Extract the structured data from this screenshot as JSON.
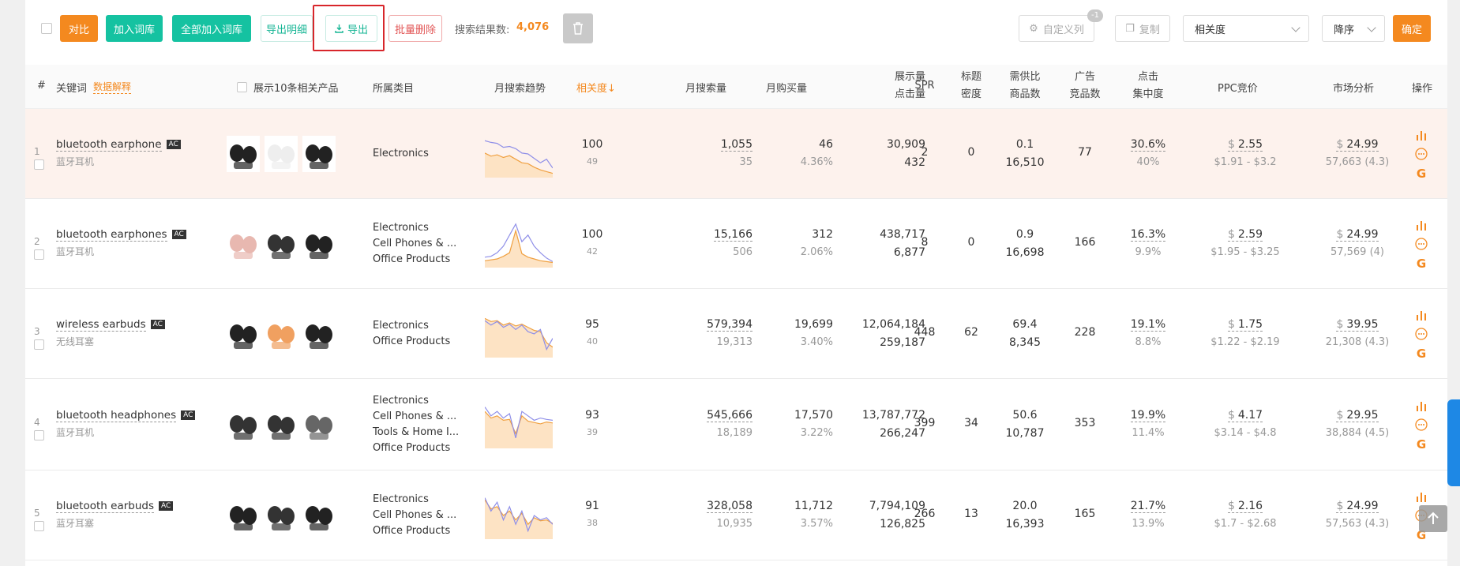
{
  "toolbar": {
    "compare": "对比",
    "add_to_library": "加入词库",
    "add_all_to_library": "全部加入词库",
    "export_detail": "导出明细",
    "export": "导出",
    "batch_delete": "批量删除",
    "result_label": "搜索结果数:",
    "result_count": "4,076",
    "custom_columns": "自定义列",
    "custom_columns_badge": "-1",
    "copy": "复制",
    "sort_field": "相关度",
    "sort_order": "降序",
    "confirm": "确定"
  },
  "headers": {
    "index": "#",
    "keyword": "关键词",
    "data_explain": "数据解释",
    "show_products": "展示10条相关产品",
    "category": "所属类目",
    "trend": "月搜索趋势",
    "relevance": "相关度↓",
    "monthly_search": "月搜索量",
    "monthly_purchase": "月购买量",
    "impressions": "展示量",
    "clicks": "点击量",
    "spr": "SPR",
    "title_density_1": "标题",
    "title_density_2": "密度",
    "supply_demand_1": "需供比",
    "supply_demand_2": "商品数",
    "ads_1": "广告",
    "ads_2": "竞品数",
    "click_conc_1": "点击",
    "click_conc_2": "集中度",
    "ppc": "PPC竞价",
    "market": "市场分析",
    "ops": "操作"
  },
  "rows": [
    {
      "index": "1",
      "keyword": "bluetooth earphone",
      "ac": "AC",
      "translation": "蓝牙耳机",
      "categories": [
        "Electronics"
      ],
      "relevance": "100",
      "relevance_sub": "49",
      "search": "1,055",
      "search_sub": "35",
      "purchase": "46",
      "purchase_sub": "4.36%",
      "impressions": "30,909",
      "clicks": "432",
      "spr": "2",
      "density": "0",
      "ratio": "0.1",
      "products": "16,510",
      "ads": "77",
      "conc": "30.6%",
      "conc_sub": "40%",
      "ppc_symbol": "$",
      "ppc": "2.55",
      "ppc_range": "$1.91 - $3.2",
      "price_symbol": "$",
      "price": "24.99",
      "price_sub": "57,663 (4.3)",
      "trend_blue": [
        0.2,
        0.24,
        0.26,
        0.35,
        0.33,
        0.38,
        0.48,
        0.5,
        0.6,
        0.7,
        0.62,
        0.82
      ],
      "trend_orange": [
        0.48,
        0.55,
        0.52,
        0.58,
        0.54,
        0.62,
        0.7,
        0.72,
        0.8,
        0.86,
        0.9,
        0.94
      ]
    },
    {
      "index": "2",
      "keyword": "bluetooth earphones",
      "ac": "AC",
      "translation": "蓝牙耳机",
      "categories": [
        "Electronics",
        "Cell Phones & ...",
        "Office Products"
      ],
      "relevance": "100",
      "relevance_sub": "42",
      "search": "15,166",
      "search_sub": "506",
      "purchase": "312",
      "purchase_sub": "2.06%",
      "impressions": "438,717",
      "clicks": "6,877",
      "spr": "8",
      "density": "0",
      "ratio": "0.9",
      "products": "16,698",
      "ads": "166",
      "conc": "16.3%",
      "conc_sub": "9.9%",
      "ppc_symbol": "$",
      "ppc": "2.59",
      "ppc_range": "$1.95 - $3.25",
      "price_symbol": "$",
      "price": "24.99",
      "price_sub": "57,569 (4)",
      "trend_blue": [
        0.8,
        0.78,
        0.7,
        0.55,
        0.3,
        0.05,
        0.45,
        0.3,
        0.55,
        0.7,
        0.82,
        0.9
      ],
      "trend_orange": [
        0.88,
        0.86,
        0.84,
        0.78,
        0.7,
        0.2,
        0.72,
        0.8,
        0.84,
        0.88,
        0.9,
        0.92
      ]
    },
    {
      "index": "3",
      "keyword": "wireless earbuds",
      "ac": "AC",
      "translation": "无线耳塞",
      "categories": [
        "Electronics",
        "Office Products"
      ],
      "relevance": "95",
      "relevance_sub": "40",
      "search": "579,394",
      "search_sub": "19,313",
      "purchase": "19,699",
      "purchase_sub": "3.40%",
      "impressions": "12,064,184",
      "clicks": "259,187",
      "spr": "448",
      "density": "62",
      "ratio": "69.4",
      "products": "8,345",
      "ads": "228",
      "conc": "19.1%",
      "conc_sub": "8.8%",
      "ppc_symbol": "$",
      "ppc": "1.75",
      "ppc_range": "$1.22 - $2.19",
      "price_symbol": "$",
      "price": "39.95",
      "price_sub": "21,308 (4.3)",
      "trend_blue": [
        0.2,
        0.3,
        0.22,
        0.35,
        0.28,
        0.4,
        0.3,
        0.45,
        0.5,
        0.4,
        0.85,
        0.6
      ],
      "trend_orange": [
        0.15,
        0.22,
        0.2,
        0.3,
        0.25,
        0.32,
        0.28,
        0.35,
        0.42,
        0.45,
        0.7,
        0.8
      ]
    },
    {
      "index": "4",
      "keyword": "bluetooth headphones",
      "ac": "AC",
      "translation": "蓝牙耳机",
      "categories": [
        "Electronics",
        "Cell Phones & ...",
        "Tools & Home I...",
        "Office Products"
      ],
      "relevance": "93",
      "relevance_sub": "39",
      "search": "545,666",
      "search_sub": "18,189",
      "purchase": "17,570",
      "purchase_sub": "3.22%",
      "impressions": "13,787,772",
      "clicks": "266,247",
      "spr": "399",
      "density": "34",
      "ratio": "50.6",
      "products": "10,787",
      "ads": "353",
      "conc": "19.9%",
      "conc_sub": "11.4%",
      "ppc_symbol": "$",
      "ppc": "4.17",
      "ppc_range": "$3.14 - $4.8",
      "price_symbol": "$",
      "price": "29.95",
      "price_sub": "38,884 (4.5)",
      "trend_blue": [
        0.1,
        0.3,
        0.2,
        0.35,
        0.25,
        0.8,
        0.2,
        0.3,
        0.4,
        0.35,
        0.38,
        0.4
      ],
      "trend_orange": [
        0.2,
        0.35,
        0.3,
        0.4,
        0.38,
        0.7,
        0.3,
        0.42,
        0.45,
        0.48,
        0.44,
        0.46
      ]
    },
    {
      "index": "5",
      "keyword": "bluetooth earbuds",
      "ac": "AC",
      "translation": "蓝牙耳塞",
      "categories": [
        "Electronics",
        "Cell Phones & ...",
        "Office Products"
      ],
      "relevance": "91",
      "relevance_sub": "38",
      "search": "328,058",
      "search_sub": "10,935",
      "purchase": "11,712",
      "purchase_sub": "3.57%",
      "impressions": "7,794,109",
      "clicks": "126,825",
      "spr": "266",
      "density": "13",
      "ratio": "20.0",
      "products": "16,393",
      "ads": "165",
      "conc": "21.7%",
      "conc_sub": "13.9%",
      "ppc_symbol": "$",
      "ppc": "2.16",
      "ppc_range": "$1.7 - $2.68",
      "price_symbol": "$",
      "price": "24.99",
      "price_sub": "57,563 (4.3)",
      "trend_blue": [
        0.1,
        0.4,
        0.2,
        0.6,
        0.3,
        0.7,
        0.4,
        0.85,
        0.5,
        0.6,
        0.55,
        0.7
      ],
      "trend_orange": [
        0.15,
        0.35,
        0.3,
        0.5,
        0.4,
        0.6,
        0.45,
        0.7,
        0.55,
        0.62,
        0.6,
        0.68
      ]
    }
  ],
  "colors": {
    "orange": "#f4891f",
    "green": "#15c2a1",
    "trend_blue": "#8f8fe8",
    "trend_orange": "#f0a040",
    "trend_fill": "#fde3c4"
  }
}
